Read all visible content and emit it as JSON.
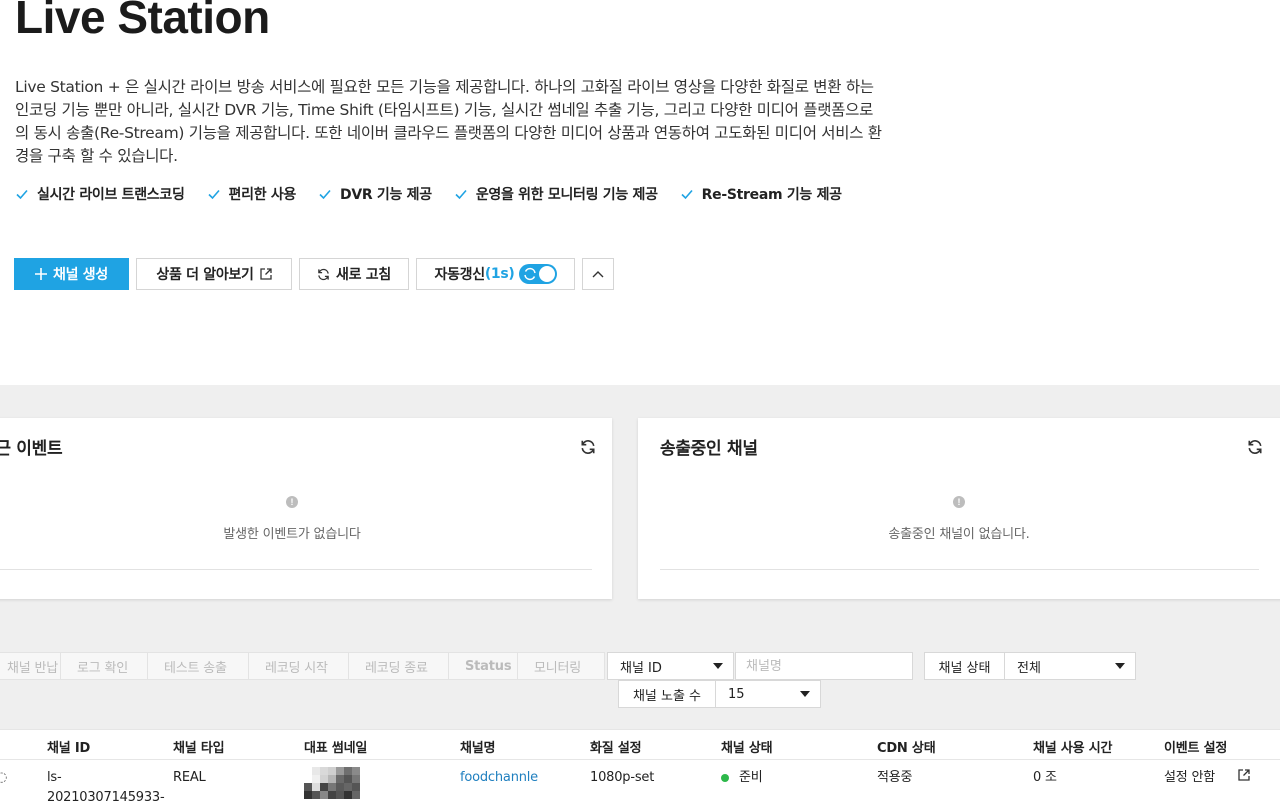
{
  "page": {
    "title": "Live Station",
    "description": "Live Station + 은 실시간 라이브 방송 서비스에 필요한 모든 기능을 제공합니다. 하나의 고화질 라이브 영상을 다양한 화질로 변환 하는 인코딩 기능 뿐만 아니라, 실시간 DVR 기능, Time Shift (타임시프트) 기능, 실시간 썸네일 추출 기능, 그리고 다양한 미디어 플랫폼으로의 동시 송출(Re-Stream) 기능을 제공합니다. 또한 네이버 클라우드 플랫폼의 다양한 미디어 상품과 연동하여 고도화된 미디어 서비스 환경을 구축 할 수 있습니다.",
    "features": [
      "실시간 라이브 트랜스코딩",
      "편리한 사용",
      "DVR 기능 제공",
      "운영을 위한 모니터링 기능 제공",
      "Re-Stream 기능 제공"
    ]
  },
  "toolbar": {
    "create_label": "채널 생성",
    "learn_more_label": "상품 더 알아보기",
    "refresh_label": "새로 고침",
    "auto_refresh_label": "자동갱신",
    "auto_refresh_interval": "(1s)",
    "auto_refresh_on": true
  },
  "cards": {
    "events": {
      "title": "최근 이벤트",
      "empty": "발생한 이벤트가 없습니다"
    },
    "streaming": {
      "title": "송출중인 채널",
      "empty": "송출중인 채널이 없습니다."
    }
  },
  "actions": [
    "채널 반납",
    "로그 확인",
    "테스트 송출",
    "레코딩 시작",
    "레코딩 종료",
    "Status",
    "모니터링"
  ],
  "filters": {
    "search_type": "채널 ID",
    "search_placeholder": "채널명",
    "status_label": "채널 상태",
    "status_value": "전체",
    "page_size_label": "채널 노출 수",
    "page_size_value": "15"
  },
  "table": {
    "headers": [
      "채널 ID",
      "채널 타입",
      "대표 썸네일",
      "채널명",
      "화질 설정",
      "채널 상태",
      "CDN 상태",
      "채널 사용 시간",
      "이벤트 설정"
    ],
    "row": {
      "channel_id_1": "ls-",
      "channel_id_2": "20210307145933-",
      "type": "REAL",
      "name": "foodchannle",
      "quality": "1080p-set",
      "status": "준비",
      "cdn": "적용중",
      "usage_time": "0 조",
      "event": "설정 안함"
    }
  },
  "colors": {
    "accent": "#1fa3e3",
    "status_ready": "#2db84a",
    "link": "#1f7fbf"
  }
}
